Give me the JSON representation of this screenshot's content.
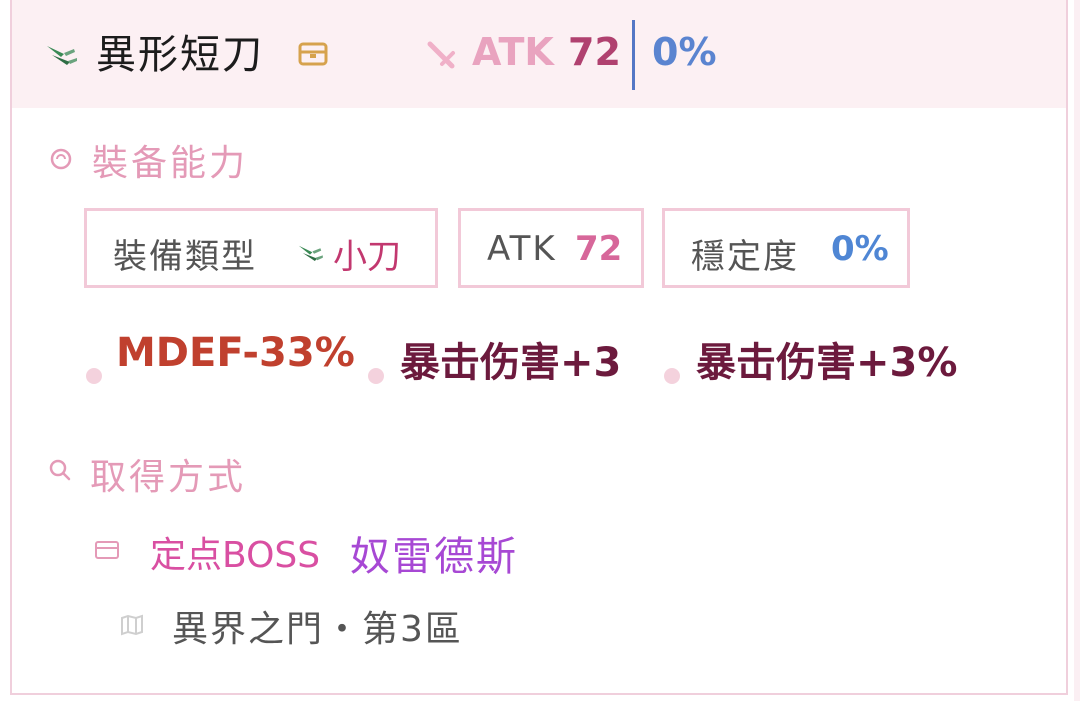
{
  "header": {
    "icon": "dagger-icon",
    "item_name": "異形短刀",
    "badge_icon": "treasure-box-icon",
    "atk_icon": "sword-icon",
    "atk_label": "ATK",
    "atk_value": "72",
    "stability_value": "0%"
  },
  "equip_section": {
    "icon": "ring-icon",
    "title": "裝备能力",
    "chips": [
      {
        "label": "裝備類型",
        "icon": "dagger-icon",
        "value": "小刀",
        "value_color": "#c2386f"
      },
      {
        "label": "ATK",
        "value": "72",
        "value_color": "#d7679a"
      },
      {
        "label": "穩定度",
        "value": "0%",
        "value_color": "#4f86d4"
      }
    ],
    "effects": [
      {
        "text": "MDEF-33%",
        "color": "#c0402e"
      },
      {
        "text": "暴击伤害+3",
        "color": "#6c1a3d"
      },
      {
        "text": "暴击伤害+3%",
        "color": "#6c1a3d"
      }
    ]
  },
  "acquire_section": {
    "icon": "search-icon",
    "title": "取得方式",
    "entry_icon": "envelope-icon",
    "entry_label": "定点BOSS",
    "boss_name": "奴雷德斯",
    "location_icon": "map-icon",
    "location": "異界之門・第3區"
  },
  "colors": {
    "accent_pink": "#e49ab7",
    "header_bg": "#fcf0f3",
    "border_pink": "#f2c9d8",
    "blue": "#5477c5",
    "boss_purple": "#a748d4"
  }
}
